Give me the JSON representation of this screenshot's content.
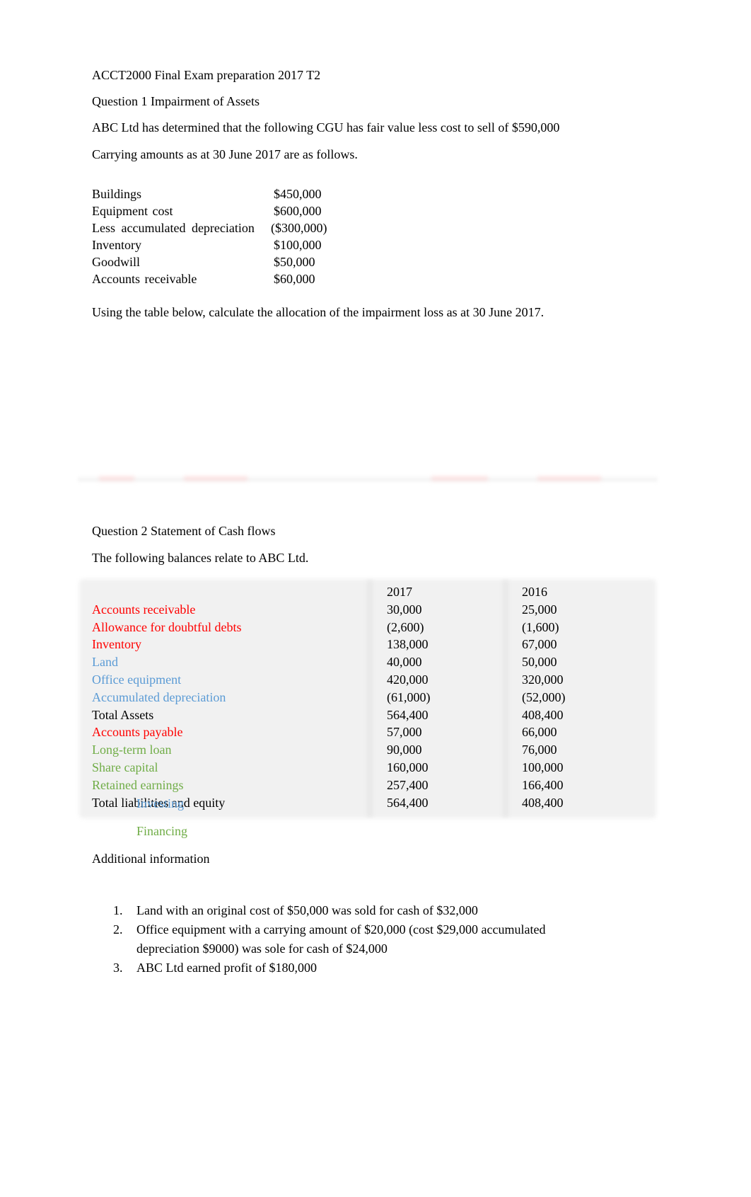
{
  "document": {
    "title": "ACCT2000 Final Exam preparation 2017 T2",
    "question1": {
      "heading": "Question 1 Impairment of Assets",
      "intro": "ABC Ltd has determined that the following CGU has fair value less cost to sell of $590,000",
      "carrying_intro": "Carrying amounts as at 30 June 2017 are as follows.",
      "items": [
        {
          "label": "Buildings",
          "value": "$450,000"
        },
        {
          "label": "Equipment cost",
          "value": "$600,000"
        },
        {
          "label": "Less accumulated depreciation",
          "value": "($300,000)"
        },
        {
          "label": "Inventory",
          "value": "$100,000"
        },
        {
          "label": "Goodwill",
          "value": "$50,000"
        },
        {
          "label": "Accounts receivable",
          "value": "$60,000"
        }
      ],
      "instruction": "Using the table below, calculate the allocation of the impairment loss as at 30 June 2017."
    },
    "question2": {
      "heading": "Question 2 Statement of Cash flows",
      "intro": "The following balances relate to ABC Ltd.",
      "columns": [
        "",
        "2017",
        "2016"
      ],
      "rows": [
        {
          "label": "Accounts receivable",
          "y2017": "30,000",
          "y2016": "25,000",
          "category": "operating"
        },
        {
          "label": "Allowance for doubtful debts",
          "y2017": "(2,600)",
          "y2016": "(1,600)",
          "category": "operating"
        },
        {
          "label": "Inventory",
          "y2017": "138,000",
          "y2016": "67,000",
          "category": "operating"
        },
        {
          "label": "Land",
          "y2017": "40,000",
          "y2016": "50,000",
          "category": "investing"
        },
        {
          "label": "Office equipment",
          "y2017": "420,000",
          "y2016": "320,000",
          "category": "investing"
        },
        {
          "label": "Accumulated depreciation",
          "y2017": "(61,000)",
          "y2016": "(52,000)",
          "category": "investing"
        },
        {
          "label": "Total Assets",
          "y2017": "564,400",
          "y2016": "408,400",
          "category": "total"
        },
        {
          "label": "Accounts payable",
          "y2017": "57,000",
          "y2016": "66,000",
          "category": "operating"
        },
        {
          "label": "Long-term loan",
          "y2017": "90,000",
          "y2016": "76,000",
          "category": "financing"
        },
        {
          "label": "Share capital",
          "y2017": "160,000",
          "y2016": "100,000",
          "category": "financing"
        },
        {
          "label": "Retained earnings",
          "y2017": "257,400",
          "y2016": "166,400",
          "category": "financing"
        },
        {
          "label": "Total liabilities and equity",
          "y2017": "564,400",
          "y2016": "408,400",
          "category": "total"
        }
      ],
      "legend": {
        "investing": "Investing",
        "financing": "Financing"
      },
      "additional_heading": "Additional information",
      "additional_items": [
        {
          "num": "1.",
          "text": "Land with an original cost of $50,000 was sold for cash of $32,000"
        },
        {
          "num": "2.",
          "text": "Office equipment with a carrying amount of $20,000 (cost $29,000 accumulated depreciation $9000) was sole for cash of $24,000"
        },
        {
          "num": "3.",
          "text": "ABC Ltd earned profit of $180,000"
        }
      ]
    },
    "colors": {
      "operating": "#ff0000",
      "investing": "#5b9bd5",
      "financing": "#70ad47",
      "total": "#000000"
    }
  }
}
